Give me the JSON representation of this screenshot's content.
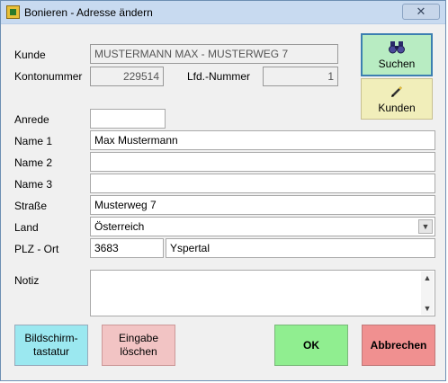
{
  "window": {
    "title": "Bonieren - Adresse ändern",
    "close_label": "✕"
  },
  "form": {
    "kunde_label": "Kunde",
    "kunde_value": "MUSTERMANN MAX   - MUSTERWEG 7",
    "kontonummer_label": "Kontonummer",
    "kontonummer_value": "229514",
    "lfd_label": "Lfd.-Nummer",
    "lfd_value": "1",
    "anrede_label": "Anrede",
    "anrede_value": "",
    "name1_label": "Name 1",
    "name1_value": "Max Mustermann",
    "name2_label": "Name 2",
    "name2_value": "",
    "name3_label": "Name 3",
    "name3_value": "",
    "strasse_label": "Straße",
    "strasse_value": "Musterweg 7",
    "land_label": "Land",
    "land_value": "Österreich",
    "plz_label": "PLZ - Ort",
    "plz_value": "3683",
    "ort_value": "Yspertal",
    "notiz_label": "Notiz",
    "notiz_value": ""
  },
  "buttons": {
    "suchen": "Suchen",
    "kunden": "Kunden",
    "bildschirm_line1": "Bildschirm-",
    "bildschirm_line2": "tastatur",
    "eingabe_line1": "Eingabe",
    "eingabe_line2": "löschen",
    "ok": "OK",
    "abbrechen": "Abbrechen"
  },
  "icons": {
    "suchen": "binoculars-icon",
    "kunden": "pencil-icon",
    "app": "app-icon"
  }
}
